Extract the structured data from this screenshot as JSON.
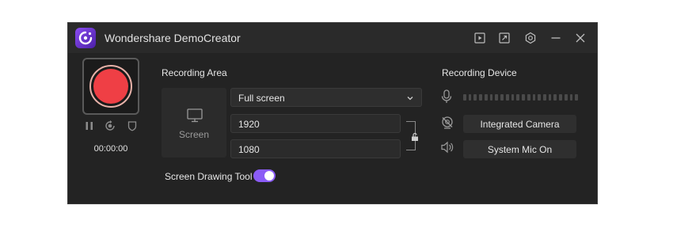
{
  "app": {
    "title": "Wondershare DemoCreator"
  },
  "titlebar": {
    "icons": [
      "logo-icon",
      "play-icon",
      "export-icon",
      "settings-icon",
      "minimize-icon",
      "close-icon"
    ]
  },
  "recorder": {
    "timer": "00:00:00",
    "controls": [
      "pause-icon",
      "restart-icon",
      "shield-icon"
    ],
    "record_color": "#ef3f45"
  },
  "recording_area": {
    "title": "Recording Area",
    "screen_label": "Screen",
    "mode": "Full screen",
    "width": "1920",
    "height": "1080"
  },
  "drawing_tool": {
    "label": "Screen Drawing Tool",
    "enabled": true,
    "accent": "#8b5cf6"
  },
  "recording_device": {
    "title": "Recording Device",
    "camera_label": "Integrated Camera",
    "mic_label": "System Mic On"
  }
}
